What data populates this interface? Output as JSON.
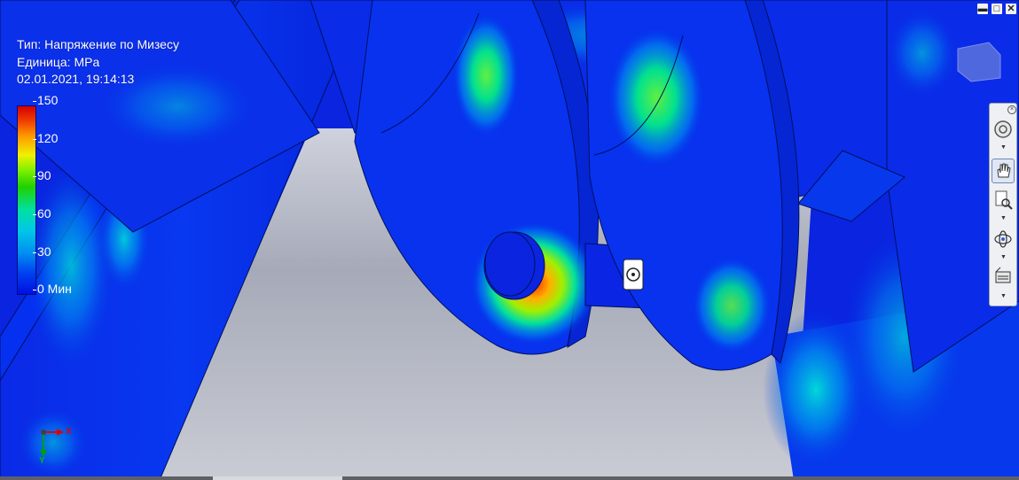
{
  "window": {
    "min_label": "▬",
    "max_label": "□",
    "close_label": "✕"
  },
  "result_info": {
    "type_line": "Тип: Напряжение по Мизесу",
    "unit_line": "Единица: MPa",
    "timestamp": "02.01.2021, 19:14:13"
  },
  "legend": {
    "ticks": [
      "150",
      "120",
      "90",
      "60",
      "30",
      "0 Мин"
    ],
    "colors": [
      "#d40000",
      "#ff9a00",
      "#f0f000",
      "#20d000",
      "#00c8e8",
      "#0010e0"
    ]
  },
  "viewcube": {
    "label": "viewcube"
  },
  "navigation_bar": {
    "tools": [
      "steering-wheel",
      "pan",
      "zoom",
      "orbit",
      "look-at"
    ]
  },
  "axis_triad": {
    "x_label": "X",
    "y_label": "Y"
  },
  "colors": {
    "background_blue": "#0a24e0",
    "floor_gray": "#b8bcc8",
    "accent_red": "#e00000"
  }
}
